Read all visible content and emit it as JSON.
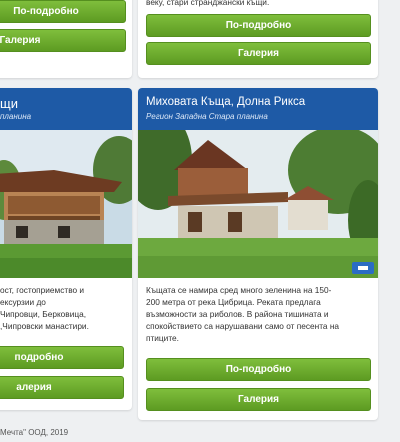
{
  "top_left": {
    "more_label": "По-подробно",
    "gallery_label": "Галерия"
  },
  "top_right": {
    "desc_tail": "веку, стари странджански къщи.",
    "more_label": "По-подробно",
    "gallery_label": "Галерия"
  },
  "left_card": {
    "title": "щи",
    "subtitle": "планина",
    "desc_lines": [
      "ост, гостоприемство и",
      "ексурзии до",
      "Чипровци, Берковица,",
      ",Чипровски манастири."
    ],
    "more_label": "подробно",
    "gallery_label": "алерия"
  },
  "right_card": {
    "title": "Миховата Къща, Долна Рикса",
    "subtitle": "Регион Западна Стара планина",
    "desc_lines": [
      "Къщата се намира сред много зеленина на 150-",
      "200 метра от река Цибрица. Реката предлага",
      "възможности за риболов. В района тишината и",
      "спокойствието са нарушавани само от песента на",
      "птиците."
    ],
    "more_label": "По-подробно",
    "gallery_label": "Галерия"
  },
  "footer": {
    "text": "Мечта\" ООД, 2019"
  },
  "colors": {
    "header_blue": "#1e5aa6",
    "button_green": "#6aab2c",
    "page_bg": "#eef0f2"
  }
}
